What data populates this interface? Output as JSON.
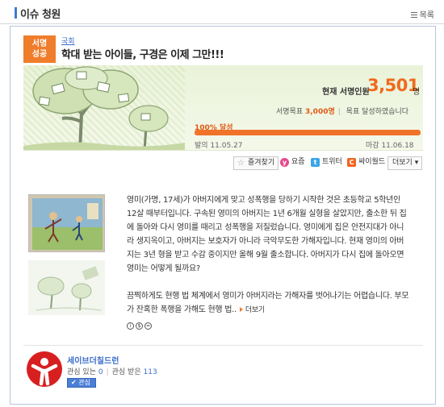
{
  "header": {
    "title": "이슈 청원",
    "more_label": "목록"
  },
  "petition": {
    "badge_line1": "서명",
    "badge_line2": "성공",
    "category": "국회",
    "title": "학대 받는 아이들, 구경은 이제 그만!!!"
  },
  "stats": {
    "current_label": "현재 서명인원",
    "current_value": "3,501",
    "current_unit": "명",
    "goal_label": "서명목표",
    "goal_value": "3,000명",
    "goal_status": "목표 달성하였습니다",
    "progress_percent_label": "100% 달성",
    "progress_fraction": 1.0,
    "start_label": "발의",
    "start_date": "11.05.27",
    "end_label": "마감",
    "end_date": "11.06.18"
  },
  "share": {
    "bookmark": "즐겨찾기",
    "yozm": "요즘",
    "twitter": "트위터",
    "cyworld": "싸이월드",
    "more": "더보기"
  },
  "content": {
    "paragraph1": "영미(가명, 17세)가 아버지에게 맞고 성폭행을 당하기 시작한 것은 초등학교 5학년인 12살 때부터입니다. 구속된 영미의 아버지는 1년 6개월 실형을 살았지만, 출소한 뒤 집에 돌아와 다시 영미를 때리고 성폭행을 저질렀습니다. 영미에게 집은 안전지대가 아니라 생지옥이고, 아버지는 보호자가 아니라 극악무도한 가해자입니다. 현재 영미의 아버지는 3년 형을 받고 수감 중이지만 올해 9월 출소합니다. 아버지가 다시 집에 돌아오면 영미는 어떻게 될까요?",
    "paragraph2": "끔찍하게도 현행 법 체계에서 영미가 아버지라는 가해자를 벗어나기는 어렵습니다. 부모가 잔혹한 폭행을 가해도 현행 법..",
    "more_label": "더보기"
  },
  "org": {
    "name": "세이브더칠드런",
    "interest_label": "관심 있는",
    "interest_count": "0",
    "received_label": "관심 받은",
    "received_count": "113",
    "button_label": "관심"
  },
  "colors": {
    "accent_orange": "#f07d2c",
    "link_blue": "#3b6ec9",
    "org_red": "#d81f1f"
  }
}
